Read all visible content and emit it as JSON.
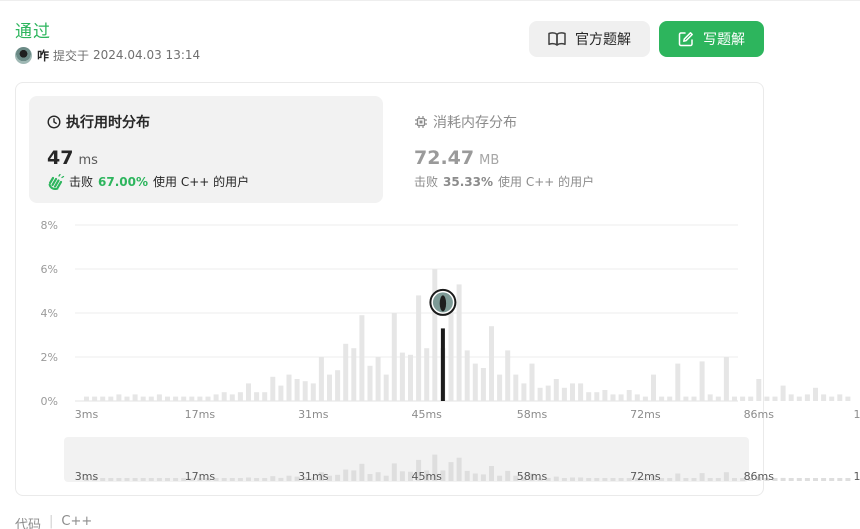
{
  "submission": {
    "status": "通过",
    "user": "咋",
    "submitted_label": "提交于",
    "submitted_at": "2024.04.03 13:14"
  },
  "actions": {
    "official_solution": "官方题解",
    "write_solution": "写题解"
  },
  "runtime": {
    "title": "执行用时分布",
    "value": "47",
    "unit": "ms",
    "beats_label": "击败",
    "beats_pct": "67.00%",
    "beats_suffix": "使用 C++ 的用户"
  },
  "memory": {
    "title": "消耗内存分布",
    "value": "72.47",
    "unit": "MB",
    "beats_label": "击败",
    "beats_pct": "35.33%",
    "beats_suffix": "使用 C++ 的用户"
  },
  "code_section": {
    "label": "代码",
    "language": "C++"
  },
  "colors": {
    "accent": "#2db55d",
    "bar": "#e6e6e6",
    "marker": "#1a1a1a"
  },
  "chart_data": {
    "type": "bar",
    "unit_x": "ms",
    "x_tick_labels": [
      "3ms",
      "17ms",
      "31ms",
      "45ms",
      "58ms",
      "72ms",
      "86ms",
      "100ms"
    ],
    "y_tick_labels": [
      "0%",
      "2%",
      "4%",
      "6%",
      "8%"
    ],
    "ylim": [
      0,
      8
    ],
    "grid": true,
    "highlight_x": 47,
    "highlight_value": 3.3,
    "bins": [
      {
        "x": 3,
        "value": 0.2
      },
      {
        "x": 4,
        "value": 0.2
      },
      {
        "x": 5,
        "value": 0.2
      },
      {
        "x": 6,
        "value": 0.2
      },
      {
        "x": 7,
        "value": 0.3
      },
      {
        "x": 8,
        "value": 0.2
      },
      {
        "x": 9,
        "value": 0.3
      },
      {
        "x": 10,
        "value": 0.2
      },
      {
        "x": 11,
        "value": 0.2
      },
      {
        "x": 12,
        "value": 0.3
      },
      {
        "x": 13,
        "value": 0.2
      },
      {
        "x": 14,
        "value": 0.2
      },
      {
        "x": 15,
        "value": 0.2
      },
      {
        "x": 16,
        "value": 0.2
      },
      {
        "x": 17,
        "value": 0.2
      },
      {
        "x": 18,
        "value": 0.2
      },
      {
        "x": 19,
        "value": 0.3
      },
      {
        "x": 20,
        "value": 0.4
      },
      {
        "x": 21,
        "value": 0.3
      },
      {
        "x": 22,
        "value": 0.4
      },
      {
        "x": 23,
        "value": 0.8
      },
      {
        "x": 24,
        "value": 0.4
      },
      {
        "x": 25,
        "value": 0.4
      },
      {
        "x": 26,
        "value": 1.1
      },
      {
        "x": 27,
        "value": 0.7
      },
      {
        "x": 28,
        "value": 1.2
      },
      {
        "x": 29,
        "value": 1.0
      },
      {
        "x": 30,
        "value": 0.9
      },
      {
        "x": 31,
        "value": 0.8
      },
      {
        "x": 32,
        "value": 2.0
      },
      {
        "x": 33,
        "value": 1.2
      },
      {
        "x": 34,
        "value": 1.4
      },
      {
        "x": 35,
        "value": 2.6
      },
      {
        "x": 36,
        "value": 2.4
      },
      {
        "x": 37,
        "value": 3.9
      },
      {
        "x": 38,
        "value": 1.6
      },
      {
        "x": 39,
        "value": 2.0
      },
      {
        "x": 40,
        "value": 1.2
      },
      {
        "x": 41,
        "value": 4.0
      },
      {
        "x": 42,
        "value": 2.2
      },
      {
        "x": 43,
        "value": 2.1
      },
      {
        "x": 44,
        "value": 4.8
      },
      {
        "x": 45,
        "value": 2.4
      },
      {
        "x": 46,
        "value": 6.0
      },
      {
        "x": 47,
        "value": 2.4
      },
      {
        "x": 48,
        "value": 4.3
      },
      {
        "x": 49,
        "value": 5.3
      },
      {
        "x": 50,
        "value": 2.3
      },
      {
        "x": 51,
        "value": 1.7
      },
      {
        "x": 52,
        "value": 1.5
      },
      {
        "x": 53,
        "value": 3.4
      },
      {
        "x": 54,
        "value": 1.2
      },
      {
        "x": 55,
        "value": 2.3
      },
      {
        "x": 56,
        "value": 1.2
      },
      {
        "x": 57,
        "value": 0.8
      },
      {
        "x": 58,
        "value": 1.7
      },
      {
        "x": 59,
        "value": 0.6
      },
      {
        "x": 60,
        "value": 0.7
      },
      {
        "x": 61,
        "value": 1.0
      },
      {
        "x": 62,
        "value": 0.6
      },
      {
        "x": 63,
        "value": 0.8
      },
      {
        "x": 64,
        "value": 0.8
      },
      {
        "x": 65,
        "value": 0.4
      },
      {
        "x": 66,
        "value": 0.4
      },
      {
        "x": 67,
        "value": 0.5
      },
      {
        "x": 68,
        "value": 0.3
      },
      {
        "x": 69,
        "value": 0.3
      },
      {
        "x": 70,
        "value": 0.5
      },
      {
        "x": 71,
        "value": 0.3
      },
      {
        "x": 72,
        "value": 0.2
      },
      {
        "x": 73,
        "value": 1.2
      },
      {
        "x": 74,
        "value": 0.2
      },
      {
        "x": 75,
        "value": 0.2
      },
      {
        "x": 76,
        "value": 1.7
      },
      {
        "x": 77,
        "value": 0.2
      },
      {
        "x": 78,
        "value": 0.2
      },
      {
        "x": 79,
        "value": 1.8
      },
      {
        "x": 80,
        "value": 0.3
      },
      {
        "x": 81,
        "value": 0.2
      },
      {
        "x": 82,
        "value": 2.0
      },
      {
        "x": 83,
        "value": 0.2
      },
      {
        "x": 84,
        "value": 0.2
      },
      {
        "x": 85,
        "value": 0.2
      },
      {
        "x": 86,
        "value": 1.0
      },
      {
        "x": 87,
        "value": 0.2
      },
      {
        "x": 88,
        "value": 0.2
      },
      {
        "x": 89,
        "value": 0.7
      },
      {
        "x": 90,
        "value": 0.3
      },
      {
        "x": 91,
        "value": 0.2
      },
      {
        "x": 92,
        "value": 0.3
      },
      {
        "x": 93,
        "value": 0.6
      },
      {
        "x": 94,
        "value": 0.3
      },
      {
        "x": 95,
        "value": 0.2
      },
      {
        "x": 96,
        "value": 0.3
      },
      {
        "x": 97,
        "value": 0.2
      }
    ]
  }
}
